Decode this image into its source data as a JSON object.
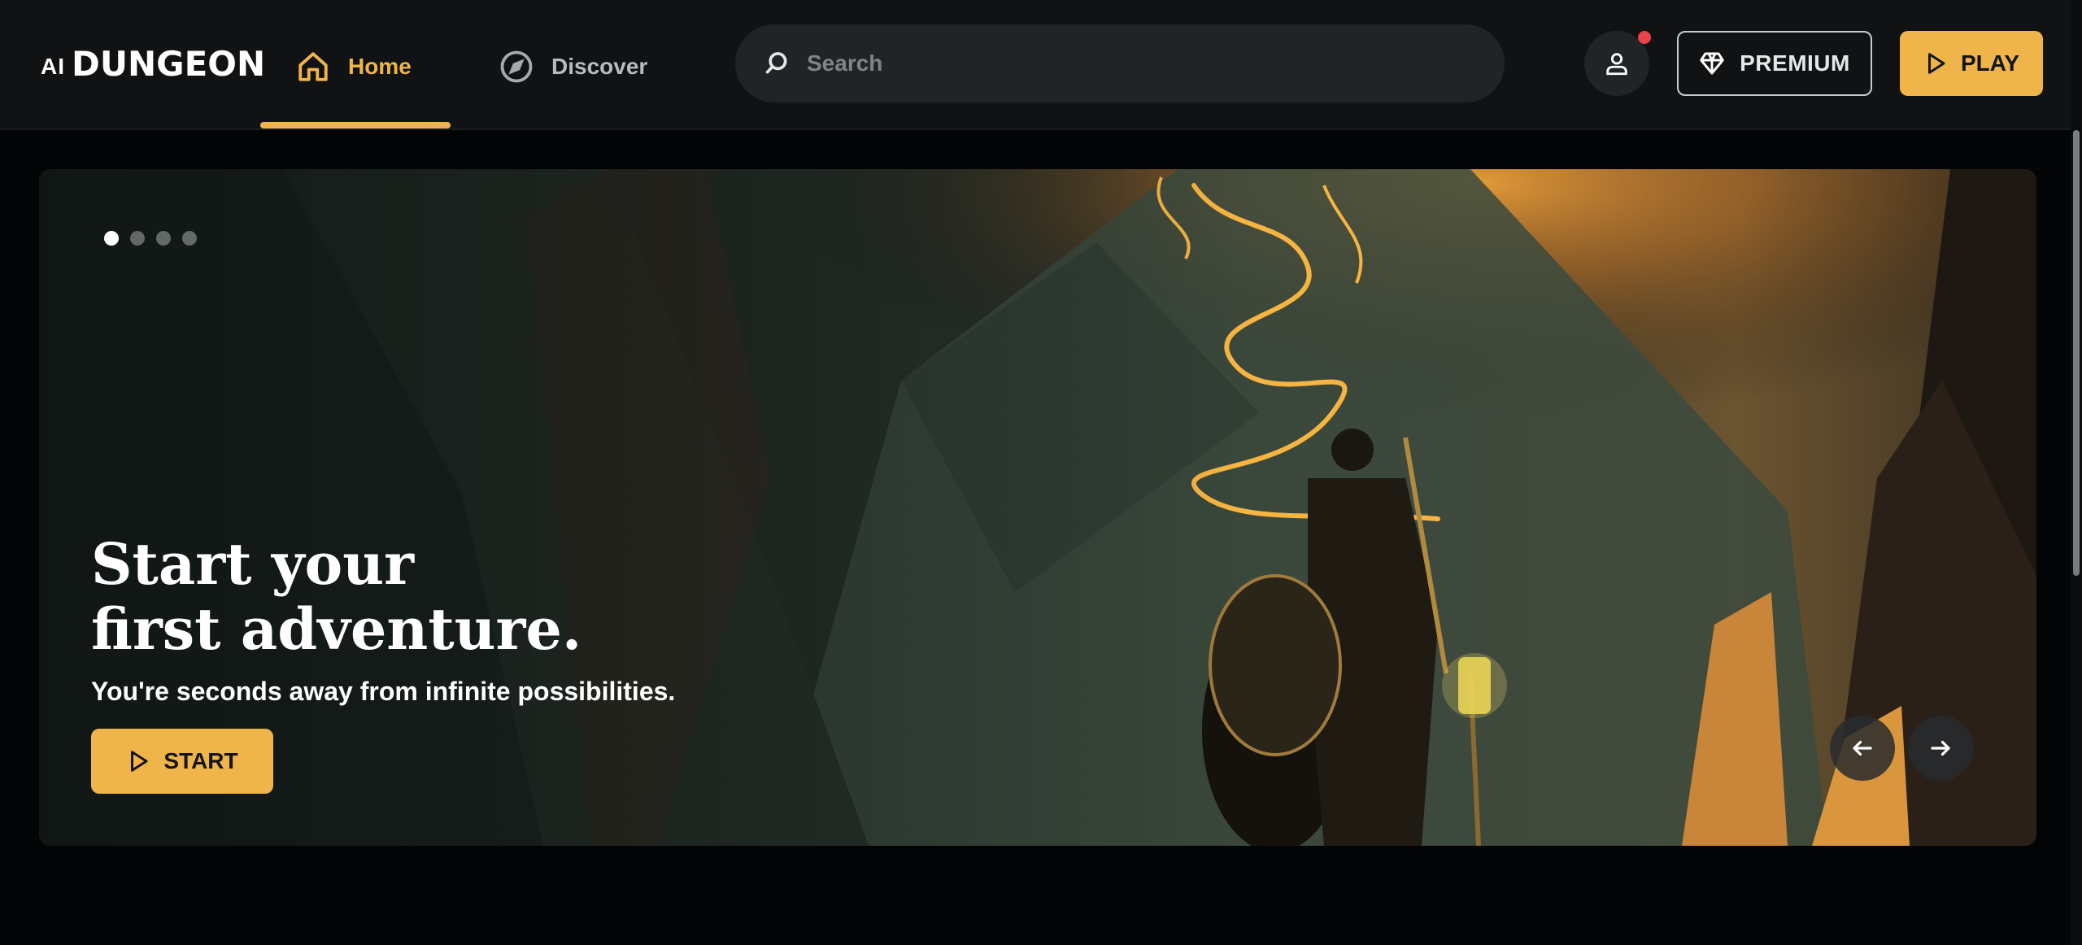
{
  "header": {
    "logo_prefix": "AI",
    "logo_name": "DUNGEON",
    "nav": [
      {
        "label": "Home",
        "icon": "home-icon",
        "active": true
      },
      {
        "label": "Discover",
        "icon": "compass-icon",
        "active": false
      }
    ],
    "search": {
      "placeholder": "Search",
      "value": ""
    },
    "premium_label": "PREMIUM",
    "play_label": "PLAY"
  },
  "hero": {
    "title_line1": "Start your",
    "title_line2": "first adventure.",
    "subtitle": "You're seconds away from infinite possibilities.",
    "start_label": "START",
    "carousel": {
      "count": 4,
      "active": 0
    }
  },
  "colors": {
    "accent": "#f0b54a",
    "background": "#030405",
    "header": "#101213",
    "notification": "#e8434b"
  }
}
